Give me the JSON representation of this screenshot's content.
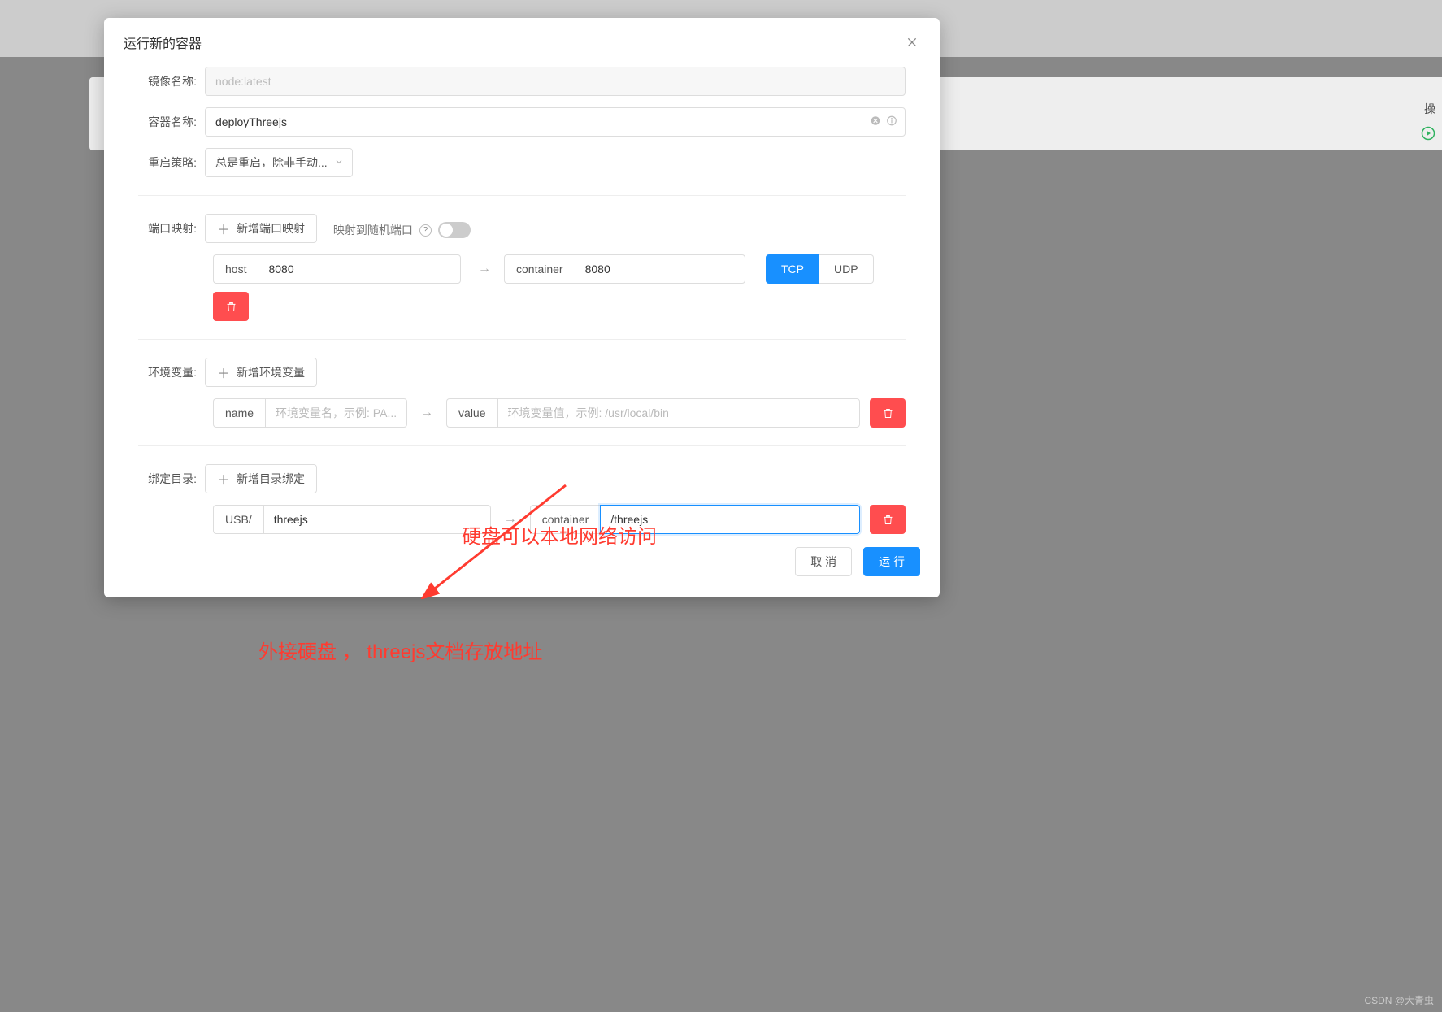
{
  "modal": {
    "title": "运行新的容器",
    "image_label": "镜像名称:",
    "image_placeholder": "node:latest",
    "container_label": "容器名称:",
    "container_value": "deployThreejs",
    "restart_label": "重启策略:",
    "restart_value": "总是重启，除非手动...",
    "port_label": "端口映射:",
    "add_port_btn": "新增端口映射",
    "random_port_label": "映射到随机端口",
    "host_label": "host",
    "host_port": "8080",
    "container_port_label": "container",
    "container_port": "8080",
    "tcp": "TCP",
    "udp": "UDP",
    "env_label": "环境变量:",
    "add_env_btn": "新增环境变量",
    "env_name_label": "name",
    "env_name_placeholder": "环境变量名，示例: PA...",
    "env_value_label": "value",
    "env_value_placeholder": "环境变量值，示例: /usr/local/bin",
    "bind_label": "绑定目录:",
    "add_bind_btn": "新增目录绑定",
    "bind_host_label": "USB/",
    "bind_host_value": "threejs",
    "bind_container_label": "container",
    "bind_container_value": "/threejs",
    "cancel": "取 消",
    "run": "运 行"
  },
  "annotations": {
    "text1": "硬盘可以本地网络访问",
    "text2": "外接硬盘 ， threejs文档存放地址"
  },
  "background": {
    "right_col": "操",
    "watermark": "CSDN @大青虫"
  }
}
